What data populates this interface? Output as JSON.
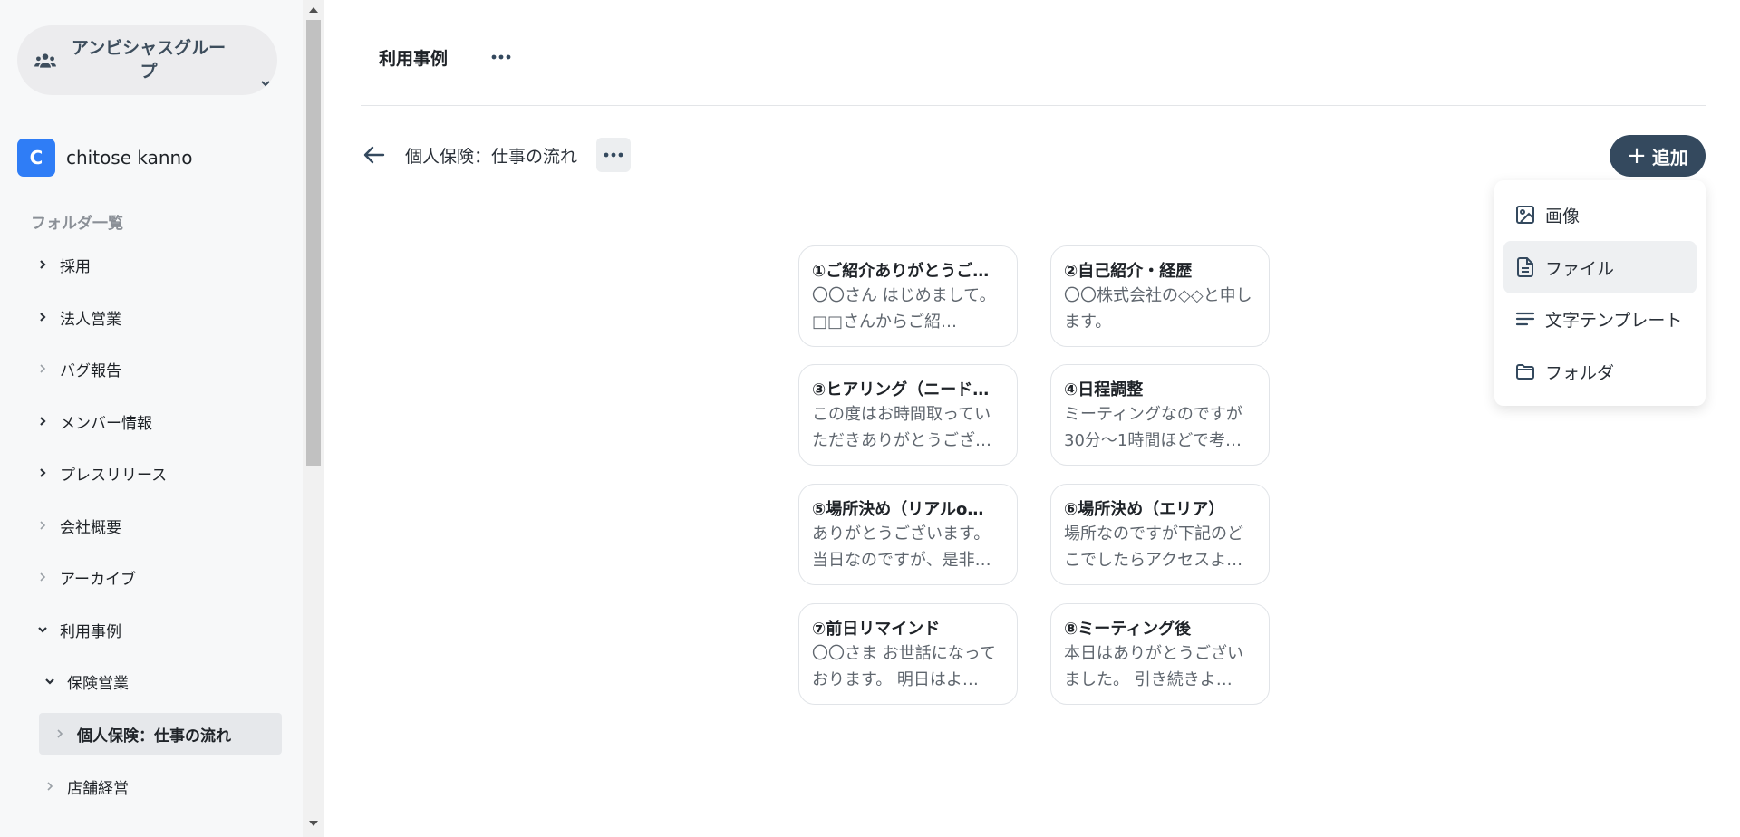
{
  "sidebar": {
    "group_name": "アンビシャスグループ",
    "user": {
      "initial": "C",
      "name": "chitose kanno"
    },
    "folder_heading": "フォルダ一覧",
    "folders": [
      {
        "label": "採用",
        "expanded": false
      },
      {
        "label": "法人営業",
        "expanded": false
      },
      {
        "label": "バグ報告",
        "expanded": false
      },
      {
        "label": "メンバー情報",
        "expanded": false
      },
      {
        "label": "プレスリリース",
        "expanded": false
      },
      {
        "label": "会社概要",
        "expanded": false
      },
      {
        "label": "アーカイブ",
        "expanded": false
      },
      {
        "label": "利用事例",
        "expanded": true
      },
      {
        "label": "保険営業",
        "expanded": true
      },
      {
        "label": "個人保険：仕事の流れ",
        "selected": true
      },
      {
        "label": "店舗経営",
        "expanded": false
      }
    ]
  },
  "header": {
    "title": "利用事例"
  },
  "breadcrumb": {
    "title": "個人保険：仕事の流れ"
  },
  "toolbar": {
    "add_label": "追加"
  },
  "add_menu": {
    "items": [
      {
        "label": "画像",
        "icon": "image-icon"
      },
      {
        "label": "ファイル",
        "icon": "file-icon"
      },
      {
        "label": "文字テンプレート",
        "icon": "text-template-icon"
      },
      {
        "label": "フォルダ",
        "icon": "folder-icon"
      }
    ]
  },
  "cards": [
    {
      "title": "①ご紹介ありがとうご…",
      "body": "〇〇さん はじめまして。 □□さんからご紹…"
    },
    {
      "title": "②自己紹介・経歴",
      "body": "〇〇株式会社の◇◇と申します。"
    },
    {
      "title": "③ヒアリング（ニード…",
      "body": "この度はお時間取っていただきありがとうござ…"
    },
    {
      "title": "④日程調整",
      "body": "ミーティングなのですが30分〜1時間ほどで考…"
    },
    {
      "title": "⑤場所決め（リアルo…",
      "body": "ありがとうございます。当日なのですが、是非…"
    },
    {
      "title": "⑥場所決め（エリア）",
      "body": "場所なのですが下記のどこでしたらアクセスよ…"
    },
    {
      "title": "⑦前日リマインド",
      "body": "〇〇さま お世話になっております。 明日はよ…"
    },
    {
      "title": "⑧ミーティング後",
      "body": "本日はありがとうございました。 引き続きよ…"
    }
  ]
}
